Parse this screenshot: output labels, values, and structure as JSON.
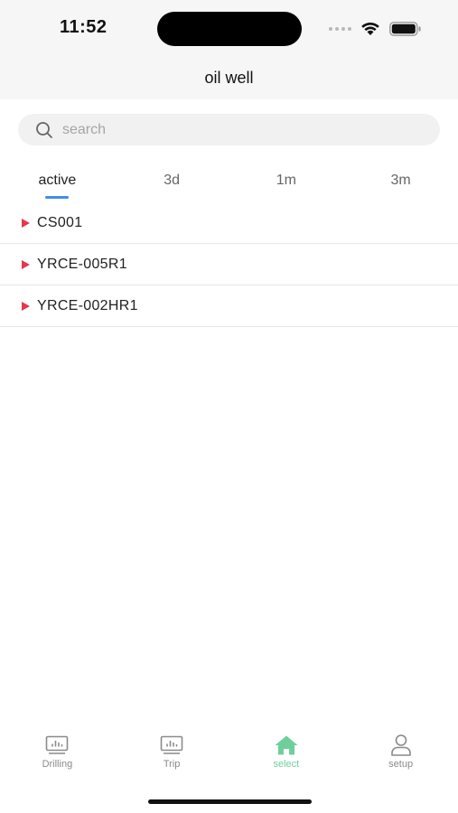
{
  "status_bar": {
    "time": "11:52"
  },
  "header": {
    "title": "oil well"
  },
  "search": {
    "placeholder": "search"
  },
  "tabs": [
    {
      "label": "active",
      "selected": true
    },
    {
      "label": "3d",
      "selected": false
    },
    {
      "label": "1m",
      "selected": false
    },
    {
      "label": "3m",
      "selected": false
    }
  ],
  "wells": [
    {
      "name": "CS001"
    },
    {
      "name": "YRCE-005R1"
    },
    {
      "name": "YRCE-002HR1"
    }
  ],
  "tabbar": {
    "items": [
      {
        "label": "Drilling",
        "icon": "monitor-chart-icon"
      },
      {
        "label": "Trip",
        "icon": "monitor-chart-icon"
      },
      {
        "label": "select",
        "icon": "home-icon",
        "active": true
      },
      {
        "label": "setup",
        "icon": "user-icon"
      }
    ]
  },
  "colors": {
    "accent_tab": "#3d8ef0",
    "well_marker": "#e8364d",
    "active_tabbar": "#6fcf9b",
    "header_bg": "#f6f6f6"
  }
}
